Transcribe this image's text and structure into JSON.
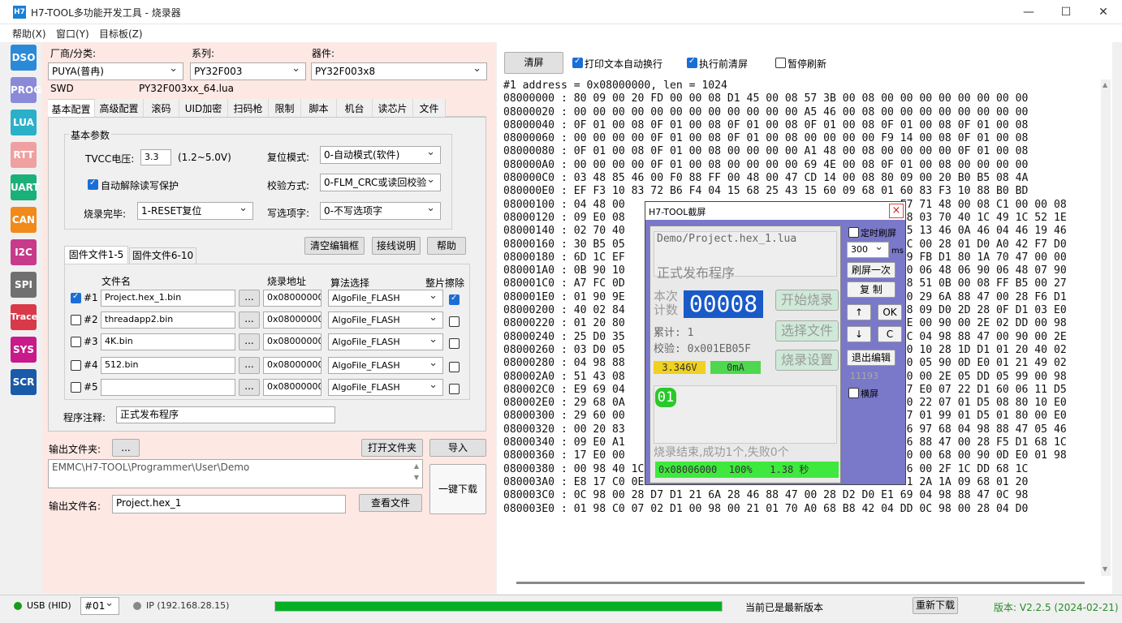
{
  "window": {
    "icon": "H7",
    "title": "H7-TOOL多功能开发工具 - 烧录器",
    "minimize": "—",
    "maximize": "☐",
    "close": "✕"
  },
  "menu": [
    "帮助(X)",
    "窗口(Y)",
    "目标板(Z)"
  ],
  "sidebar": [
    {
      "label": "DSO",
      "color": "#2a8ad8"
    },
    {
      "label": "PROG",
      "color": "#8a8ad8"
    },
    {
      "label": "LUA",
      "color": "#2ab0c8"
    },
    {
      "label": "RTT",
      "color": "#f0a0a0"
    },
    {
      "label": "UART",
      "color": "#1ab07a"
    },
    {
      "label": "CAN",
      "color": "#f08a1a"
    },
    {
      "label": "I2C",
      "color": "#c83a8a"
    },
    {
      "label": "SPI",
      "color": "#707070"
    },
    {
      "label": "Trace",
      "color": "#d83a4a"
    },
    {
      "label": "SYS",
      "color": "#c81a8a"
    },
    {
      "label": "SCR",
      "color": "#1a5aa8"
    }
  ],
  "selectors": {
    "vendor_label": "厂商/分类:",
    "vendor_value": "PUYA(普冉)",
    "series_label": "系列:",
    "series_value": "PY32F003",
    "device_label": "器件:",
    "device_value": "PY32F003x8",
    "interface": "SWD",
    "lua_file": "PY32F003xx_64.lua"
  },
  "tabs": [
    "基本配置",
    "高级配置",
    "滚码",
    "UID加密",
    "扫码枪",
    "限制",
    "脚本",
    "机台",
    "读芯片",
    "文件"
  ],
  "basic": {
    "group_title": "基本参数",
    "tvcc_label": "TVCC电压:",
    "tvcc_value": "3.3",
    "tvcc_range": "(1.2~5.0V)",
    "reset_label": "复位模式:",
    "reset_value": "0-自动模式(软件)",
    "auto_unprotect": "自动解除读写保护",
    "verify_label": "校验方式:",
    "verify_value": "0-FLM_CRC或读回校验",
    "after_label": "烧录完毕:",
    "after_value": "1-RESET复位",
    "option_label": "写选项字:",
    "option_value": "0-不写选项字"
  },
  "files": {
    "tab1": "固件文件1-5",
    "tab2": "固件文件6-10",
    "clear_btn": "清空编辑框",
    "wiring_btn": "接线说明",
    "help_btn": "帮助",
    "col_name": "文件名",
    "col_addr": "烧录地址",
    "col_algo": "算法选择",
    "col_erase": "整片擦除",
    "rows": [
      {
        "id": "#1",
        "checked": true,
        "name": "Project.hex_1.bin",
        "addr": "0x08000000",
        "algo": "AlgoFile_FLASH",
        "erase": true
      },
      {
        "id": "#2",
        "checked": false,
        "name": "threadapp2.bin",
        "addr": "0x08000000",
        "algo": "AlgoFile_FLASH",
        "erase": false
      },
      {
        "id": "#3",
        "checked": false,
        "name": "4K.bin",
        "addr": "0x08000000",
        "algo": "AlgoFile_FLASH",
        "erase": false
      },
      {
        "id": "#4",
        "checked": false,
        "name": "512.bin",
        "addr": "0x08000000",
        "algo": "AlgoFile_FLASH",
        "erase": false
      },
      {
        "id": "#5",
        "checked": false,
        "name": "",
        "addr": "0x08000000",
        "algo": "AlgoFile_FLASH",
        "erase": false
      }
    ],
    "browse": "...",
    "note_label": "程序注释:",
    "note_value": "正式发布程序"
  },
  "output": {
    "folder_label": "输出文件夹:",
    "folder_browse": "...",
    "open_folder": "打开文件夹",
    "import": "导入",
    "path": "EMMC\\H7-TOOL\\Programmer\\User\\Demo",
    "one_click": "一键下载",
    "name_label": "输出文件名:",
    "name_value": "Project.hex_1",
    "view_file": "查看文件"
  },
  "right": {
    "clear": "清屏",
    "wrap_label": "打印文本自动换行",
    "clear_before": "执行前清屏",
    "pause": "暂停刷新",
    "hex_header": "#1 address = 0x08000000, len = 1024",
    "hex_lines": [
      "08000000 : 80 09 00 20 FD 00 00 08 D1 45 00 08 57 3B 00 08 00 00 00 00 00 00 00 00",
      "08000020 : 00 00 00 00 00 00 00 00 00 00 00 00 A5 46 00 08 00 00 00 00 00 00 00 00",
      "08000040 : 0F 01 00 08 0F 01 00 08 0F 01 00 08 0F 01 00 08 0F 01 00 08 0F 01 00 08",
      "08000060 : 00 00 00 00 0F 01 00 08 0F 01 00 08 00 00 00 00 F9 14 00 08 0F 01 00 08",
      "08000080 : 0F 01 00 08 0F 01 00 08 00 00 00 00 A1 48 00 08 00 00 00 00 0F 01 00 08",
      "080000A0 : 00 00 00 00 0F 01 00 08 00 00 00 00 69 4E 00 08 0F 01 00 08 00 00 00 00",
      "080000C0 : 03 48 85 46 00 F0 88 FF 00 48 00 47 CD 14 00 08 80 09 00 20 B0 B5 08 4A",
      "080000E0 : EF F3 10 83 72 B6 F4 04 15 68 25 43 15 60 09 68 01 60 83 F3 10 88 B0 BD",
      "08000100 : 04 48 00                                           E7 71 48 00 08 C1 00 00 08",
      "08000120 : 09 E0 08                                           78 03 70 40 1C 49 1C 52 1E",
      "08000140 : 02 70 40                                           B5 13 46 0A 46 04 46 19 46",
      "08000160 : 30 B5 05                                           1C 00 28 01 D0 A0 42 F7 D0",
      "08000180 : 6D 1C EF                                           29 FB D1 80 1A 70 47 00 00",
      "080001A0 : 0B 90 10                                           90 06 48 06 90 06 48 07 90",
      "080001C0 : A7 FC 0D                                           08 51 0B 00 08 FF B5 00 27",
      "080001E0 : 01 90 9E                                           90 29 6A 88 47 00 28 F6 D1",
      "08000200 : 40 02 84                                           28 09 D0 2D 28 0F D1 03 E0",
      "08000220 : 01 20 80                                           1E 00 90 00 2E 02 DD 00 98",
      "08000240 : 25 D0 35                                           1C 04 98 88 47 00 90 00 2E",
      "08000260 : 03 D0 05                                           D0 10 28 1D D1 01 20 40 02",
      "08000280 : 04 98 88                                           20 05 90 0D E0 01 21 49 02",
      "080002A0 : 51 43 08                                           90 00 2E 05 DD 05 99 00 98",
      "080002C0 : E9 69 04                                           E7 E0 07 22 D1 60 06 11 D5",
      "080002E0 : 29 68 0A                                           E0 22 07 01 D5 08 80 10 E0",
      "08000300 : 29 60 00                                           07 01 99 01 D5 01 80 00 E0",
      "08000320 : 00 20 83                                           26 97 68 04 98 88 47 05 46",
      "08000340 : 09 E0 A1                                           46 88 47 00 28 F5 D1 68 1C",
      "08000360 : 17 E0 00                                           60 00 68 00 90 0D E0 01 98",
      "08000380 : 00 98 40 1C 00 90 A1 69 78 1C 7F 1E 04 98 88 47 05 46 00 2F 1C DD 68 1C",
      "080003A0 : E8 17 C0 0E 40 19 41 11 8A 00 06 99 40 09 51 18 40 01 2A 1A 09 68 01 20",
      "080003C0 : 0C 98 00 28 D7 D1 21 6A 28 46 88 47 00 28 D2 D0 E1 69 04 98 88 47 0C 98",
      "080003E0 : 01 98 C0 07 02 D1 00 98 00 21 01 70 A0 68 B8 42 04 DD 0C 98 00 28 04 D0"
    ]
  },
  "dialog": {
    "title": "H7-TOOL截屏",
    "close": "×",
    "path": "Demo/Project.hex_1.lua",
    "subtitle": "正式发布程序",
    "count_label_1": "本次",
    "count_label_2": "计数",
    "count_value": "00008",
    "start_btn": "开始烧录",
    "select_btn": "选择文件",
    "settings_btn": "烧录设置",
    "total": "累计: 1",
    "checksum": "校验: 0x001EB05F",
    "voltage": "3.346V",
    "current": "0mA",
    "slot": "01",
    "result": "烧录结束,成功1个,失败0个",
    "progress": "0x08006000  100%   1.38 秒",
    "timed_refresh": "定时刷屏",
    "interval": "300",
    "interval_unit": "ms",
    "refresh_once": "刷屏一次",
    "copy": "复 制",
    "up": "↑",
    "ok": "OK",
    "down": "↓",
    "c": "C",
    "exit_edit": "退出编辑",
    "counter": "11193",
    "landscape": "横屏"
  },
  "status": {
    "usb": "USB (HID)",
    "port": "#01",
    "ip": "IP (192.168.28.15)",
    "progress": 1.0,
    "message": "当前已是最新版本",
    "redownload": "重新下载",
    "version": "版本: V2.2.5 (2024-02-21)"
  }
}
